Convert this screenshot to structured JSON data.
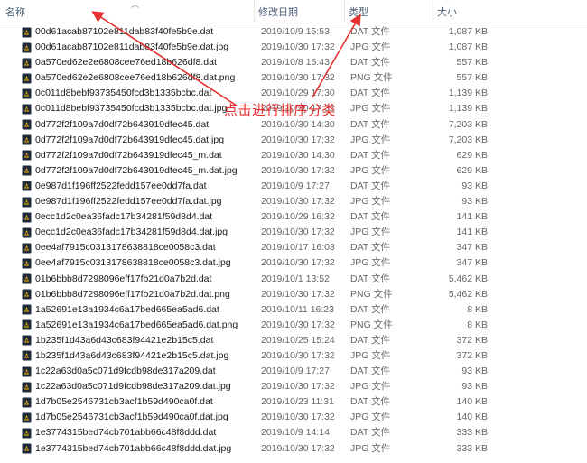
{
  "columns": {
    "name": "名称",
    "date": "修改日期",
    "type": "类型",
    "size": "大小"
  },
  "annotation": {
    "text": "点击进行排序分类",
    "color": "#e53030"
  },
  "icons": {
    "file": "file-icon",
    "sort": "sort-caret-icon",
    "arrow": "arrow-icon"
  },
  "files": [
    {
      "name": "00d61acab87102e811dab83f40fe5b9e.dat",
      "date": "2019/10/9 15:53",
      "type": "DAT 文件",
      "size": "1,087 KB"
    },
    {
      "name": "00d61acab87102e811dab83f40fe5b9e.dat.jpg",
      "date": "2019/10/30 17:32",
      "type": "JPG 文件",
      "size": "1,087 KB"
    },
    {
      "name": "0a570ed62e2e6808cee76ed18b626df8.dat",
      "date": "2019/10/8 15:43",
      "type": "DAT 文件",
      "size": "557 KB"
    },
    {
      "name": "0a570ed62e2e6808cee76ed18b626df8.dat.png",
      "date": "2019/10/30 17:32",
      "type": "PNG 文件",
      "size": "557 KB"
    },
    {
      "name": "0c011d8bebf93735450fcd3b1335bcbc.dat",
      "date": "2019/10/29 17:30",
      "type": "DAT 文件",
      "size": "1,139 KB"
    },
    {
      "name": "0c011d8bebf93735450fcd3b1335bcbc.dat.jpg",
      "date": "2019/10/30 17:32",
      "type": "JPG 文件",
      "size": "1,139 KB"
    },
    {
      "name": "0d772f2f109a7d0df72b643919dfec45.dat",
      "date": "2019/10/30 14:30",
      "type": "DAT 文件",
      "size": "7,203 KB"
    },
    {
      "name": "0d772f2f109a7d0df72b643919dfec45.dat.jpg",
      "date": "2019/10/30 17:32",
      "type": "JPG 文件",
      "size": "7,203 KB"
    },
    {
      "name": "0d772f2f109a7d0df72b643919dfec45_m.dat",
      "date": "2019/10/30 14:30",
      "type": "DAT 文件",
      "size": "629 KB"
    },
    {
      "name": "0d772f2f109a7d0df72b643919dfec45_m.dat.jpg",
      "date": "2019/10/30 17:32",
      "type": "JPG 文件",
      "size": "629 KB"
    },
    {
      "name": "0e987d1f196ff2522fedd157ee0dd7fa.dat",
      "date": "2019/10/9 17:27",
      "type": "DAT 文件",
      "size": "93 KB"
    },
    {
      "name": "0e987d1f196ff2522fedd157ee0dd7fa.dat.jpg",
      "date": "2019/10/30 17:32",
      "type": "JPG 文件",
      "size": "93 KB"
    },
    {
      "name": "0ecc1d2c0ea36fadc17b34281f59d8d4.dat",
      "date": "2019/10/29 16:32",
      "type": "DAT 文件",
      "size": "141 KB"
    },
    {
      "name": "0ecc1d2c0ea36fadc17b34281f59d8d4.dat.jpg",
      "date": "2019/10/30 17:32",
      "type": "JPG 文件",
      "size": "141 KB"
    },
    {
      "name": "0ee4af7915c0313178638818ce0058c3.dat",
      "date": "2019/10/17 16:03",
      "type": "DAT 文件",
      "size": "347 KB"
    },
    {
      "name": "0ee4af7915c0313178638818ce0058c3.dat.jpg",
      "date": "2019/10/30 17:32",
      "type": "JPG 文件",
      "size": "347 KB"
    },
    {
      "name": "01b6bbb8d7298096eff17fb21d0a7b2d.dat",
      "date": "2019/10/1 13:52",
      "type": "DAT 文件",
      "size": "5,462 KB"
    },
    {
      "name": "01b6bbb8d7298096eff17fb21d0a7b2d.dat.png",
      "date": "2019/10/30 17:32",
      "type": "PNG 文件",
      "size": "5,462 KB"
    },
    {
      "name": "1a52691e13a1934c6a17bed665ea5ad6.dat",
      "date": "2019/10/11 16:23",
      "type": "DAT 文件",
      "size": "8 KB"
    },
    {
      "name": "1a52691e13a1934c6a17bed665ea5ad6.dat.png",
      "date": "2019/10/30 17:32",
      "type": "PNG 文件",
      "size": "8 KB"
    },
    {
      "name": "1b235f1d43a6d43c683f94421e2b15c5.dat",
      "date": "2019/10/25 15:24",
      "type": "DAT 文件",
      "size": "372 KB"
    },
    {
      "name": "1b235f1d43a6d43c683f94421e2b15c5.dat.jpg",
      "date": "2019/10/30 17:32",
      "type": "JPG 文件",
      "size": "372 KB"
    },
    {
      "name": "1c22a63d0a5c071d9fcdb98de317a209.dat",
      "date": "2019/10/9 17:27",
      "type": "DAT 文件",
      "size": "93 KB"
    },
    {
      "name": "1c22a63d0a5c071d9fcdb98de317a209.dat.jpg",
      "date": "2019/10/30 17:32",
      "type": "JPG 文件",
      "size": "93 KB"
    },
    {
      "name": "1d7b05e2546731cb3acf1b59d490ca0f.dat",
      "date": "2019/10/23 11:31",
      "type": "DAT 文件",
      "size": "140 KB"
    },
    {
      "name": "1d7b05e2546731cb3acf1b59d490ca0f.dat.jpg",
      "date": "2019/10/30 17:32",
      "type": "JPG 文件",
      "size": "140 KB"
    },
    {
      "name": "1e3774315bed74cb701abb66c48f8ddd.dat",
      "date": "2019/10/9 14:14",
      "type": "DAT 文件",
      "size": "333 KB"
    },
    {
      "name": "1e3774315bed74cb701abb66c48f8ddd.dat.jpg",
      "date": "2019/10/30 17:32",
      "type": "JPG 文件",
      "size": "333 KB"
    }
  ]
}
